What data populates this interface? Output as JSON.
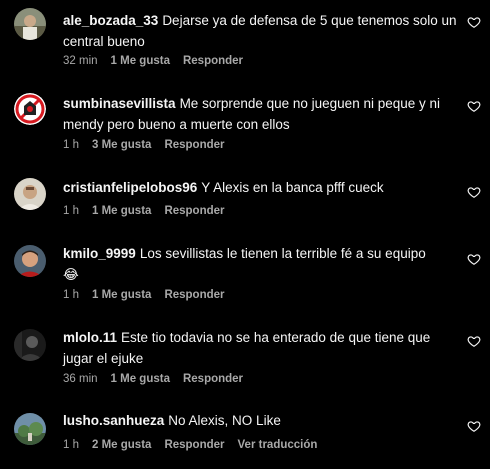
{
  "comments": [
    {
      "username": "ale_bozada_33",
      "text": "Dejarse ya de defensa de 5 que tenemos solo un central bueno",
      "time": "32 min",
      "likes": "1 Me gusta",
      "reply": "Responder",
      "avatar": "photo"
    },
    {
      "username": "sumbinasevillista",
      "text": "Me sorprende que no jueguen ni peque y ni mendy pero bueno a muerte con ellos",
      "time": "1 h",
      "likes": "3 Me gusta",
      "reply": "Responder",
      "avatar": "crest"
    },
    {
      "username": "cristianfelipelobos96",
      "text": "Y Alexis en la banca pfff cueck",
      "time": "1 h",
      "likes": "1 Me gusta",
      "reply": "Responder",
      "avatar": "photo"
    },
    {
      "username": "kmilo_9999",
      "text": "Los sevillistas le tienen la terrible fé a su equipo",
      "emoji": "😂",
      "time": "1 h",
      "likes": "1 Me gusta",
      "reply": "Responder",
      "avatar": "photo"
    },
    {
      "username": "mlolo.11",
      "text": "Este tio todavia no se ha enterado de que tiene que jugar el ejuke",
      "time": "36 min",
      "likes": "1 Me gusta",
      "reply": "Responder",
      "avatar": "photo"
    },
    {
      "username": "lusho.sanhueza",
      "text": "No Alexis, NO Like",
      "time": "1 h",
      "likes": "2 Me gusta",
      "reply": "Responder",
      "translate": "Ver traducción",
      "avatar": "photo"
    }
  ],
  "colors": {
    "background": "#000000",
    "text": "#f5f5f5",
    "meta": "#a8a8a8",
    "crest_red": "#d71920"
  },
  "icons": {
    "like": "heart-outline-icon"
  }
}
